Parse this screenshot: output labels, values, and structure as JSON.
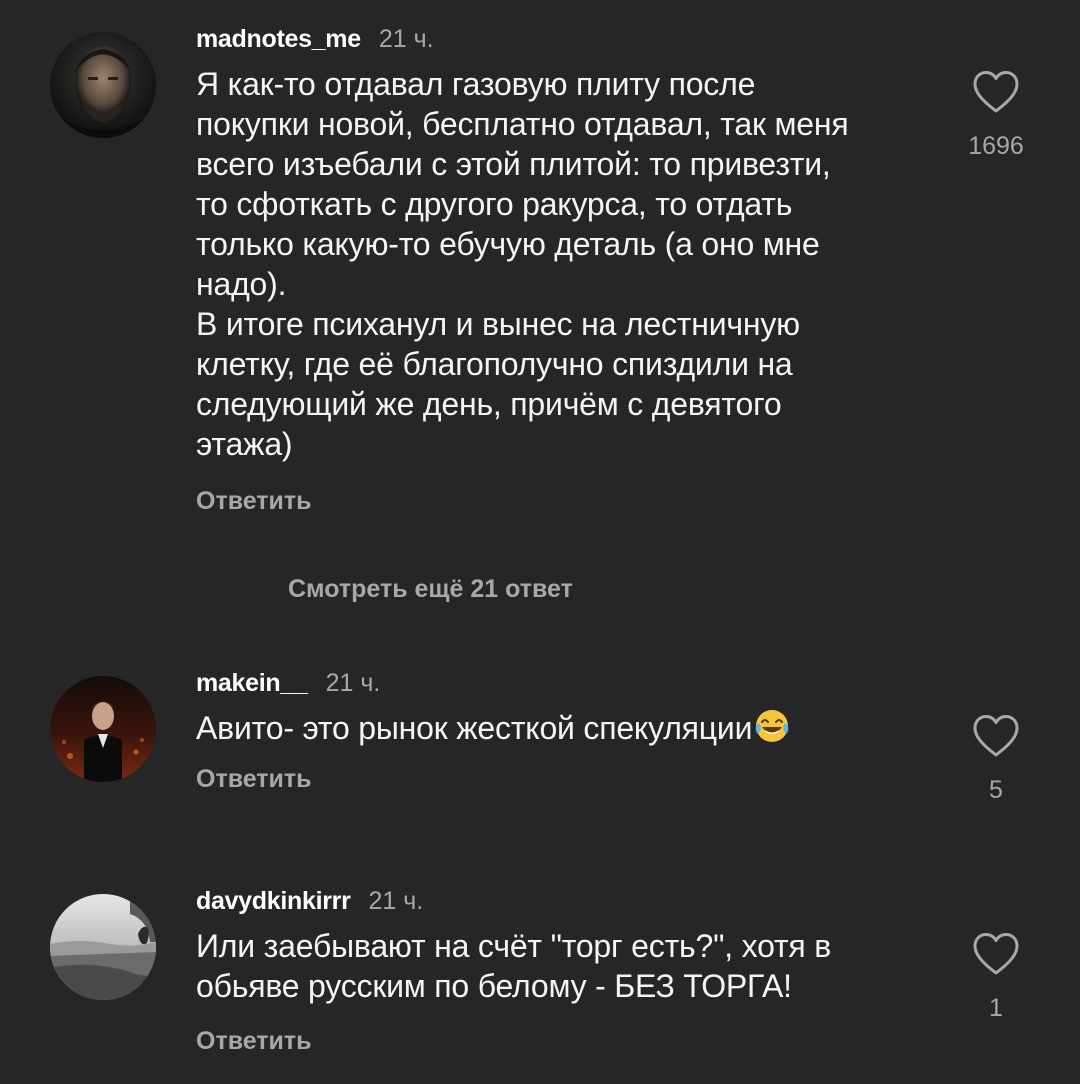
{
  "comments": [
    {
      "username": "madnotes_me",
      "time": "21 ч.",
      "text": "Я как-то отдавал газовую плиту после\nпокупки новой, бесплатно отдавал, так меня\nвсего изъебали с этой плитой: то привезти,\nто сфоткать с другого ракурса, то отдать\nтолько какую-то ебучую деталь (а оно мне\nнадо).\nВ итоге психанул и вынес на лестничную\nклетку, где её благополучно спиздили на\nследующий же день, причём с девятого\nэтажа)",
      "reply_label": "Ответить",
      "likes": "1696",
      "avatar_icon": "user-avatar-man-dark-portrait"
    },
    {
      "username": "makein__",
      "time": "21 ч.",
      "text": "Авито- это рынок жесткой спекуляции",
      "emoji": "face-with-tears-of-joy",
      "reply_label": "Ответить",
      "likes": "5",
      "avatar_icon": "user-avatar-man-suit-red-background"
    },
    {
      "username": "davydkinkirrr",
      "time": "21 ч.",
      "text": "Или заебывают на счёт \"торг есть?\", хотя в\nобьяве русским по белому - БЕЗ ТОРГА!",
      "reply_label": "Ответить",
      "likes": "1",
      "avatar_icon": "user-avatar-grayscale-seascape"
    }
  ],
  "more_replies_label": "Смотреть ещё 21 ответ",
  "colors": {
    "background": "#262629",
    "text_primary": "#f5f5f5",
    "text_secondary": "#a8a8a8"
  }
}
